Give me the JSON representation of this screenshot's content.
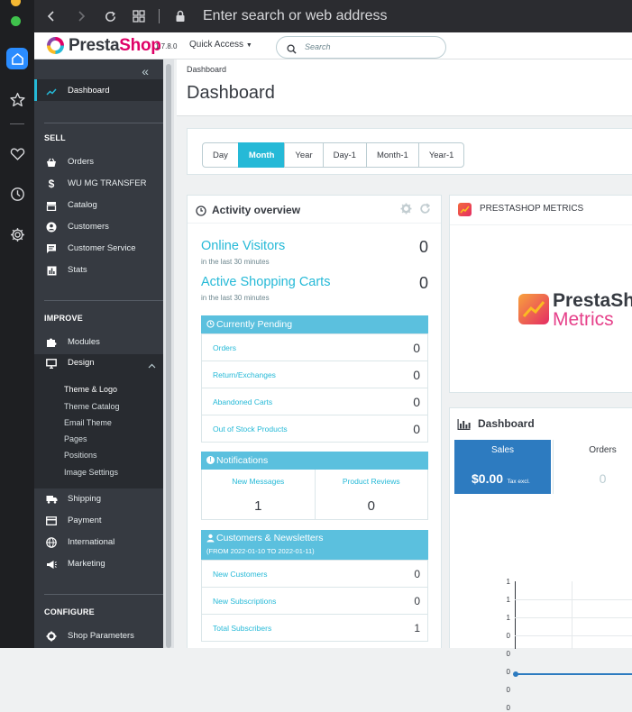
{
  "browser": {
    "address_placeholder": "Enter search or web address",
    "accent": "#2a8cff"
  },
  "header": {
    "logo_brand": "Presta",
    "logo_shop": "Shop",
    "version": "1.7.8.0",
    "quick_access": "Quick Access",
    "search_placeholder": "Search",
    "brand_color": "#25b9d7"
  },
  "sidebar": {
    "dashboard": "Dashboard",
    "sell_title": "SELL",
    "sell_items": [
      "Orders",
      "WU MG TRANSFER",
      "Catalog",
      "Customers",
      "Customer Service",
      "Stats"
    ],
    "improve_title": "IMPROVE",
    "modules": "Modules",
    "design": "Design",
    "design_sub": [
      "Theme & Logo",
      "Theme Catalog",
      "Email Theme",
      "Pages",
      "Positions",
      "Image Settings"
    ],
    "improve_items": [
      "Shipping",
      "Payment",
      "International",
      "Marketing"
    ],
    "configure_title": "CONFIGURE",
    "shop_parameters": "Shop Parameters"
  },
  "page": {
    "breadcrumb": "Dashboard",
    "title": "Dashboard"
  },
  "periods": {
    "buttons": [
      "Day",
      "Month",
      "Year",
      "Day-1",
      "Month-1",
      "Year-1"
    ],
    "active": "Month"
  },
  "activity": {
    "title": "Activity overview",
    "online_visitors_label": "Online Visitors",
    "online_visitors_sub": "in the last 30 minutes",
    "online_visitors_value": "0",
    "active_carts_label": "Active Shopping Carts",
    "active_carts_sub": "in the last 30 minutes",
    "active_carts_value": "0",
    "pending_title": "Currently Pending",
    "pending_rows": [
      {
        "label": "Orders",
        "value": "0"
      },
      {
        "label": "Return/Exchanges",
        "value": "0"
      },
      {
        "label": "Abandoned Carts",
        "value": "0"
      },
      {
        "label": "Out of Stock Products",
        "value": "0"
      }
    ],
    "notifications_title": "Notifications",
    "new_messages_label": "New Messages",
    "new_messages_value": "1",
    "product_reviews_label": "Product Reviews",
    "product_reviews_value": "0",
    "customers_title": "Customers & Newsletters",
    "customers_range": "(FROM 2022-01-10 TO 2022-01-11)",
    "customer_rows": [
      {
        "label": "New Customers",
        "value": "0"
      },
      {
        "label": "New Subscriptions",
        "value": "0"
      },
      {
        "label": "Total Subscribers",
        "value": "1"
      }
    ]
  },
  "metrics": {
    "title": "PRESTASHOP METRICS",
    "logo_line1": "PrestaSho",
    "logo_line2": "Metrics"
  },
  "dashboard_card": {
    "title": "Dashboard",
    "sales_label": "Sales",
    "sales_value": "$0.00",
    "sales_suffix": "Tax excl.",
    "orders_label": "Orders",
    "orders_value": "0",
    "y_ticks": [
      "1",
      "1",
      "1",
      "0",
      "0",
      "0",
      "0",
      "0"
    ]
  }
}
